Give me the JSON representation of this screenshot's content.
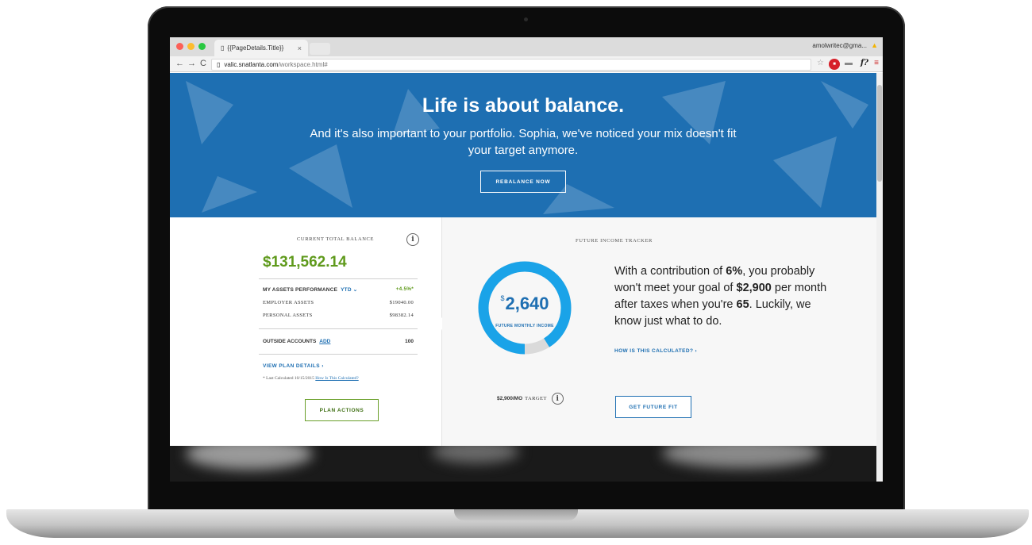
{
  "browser": {
    "tab_title": "{{PageDetails.Title}}",
    "tab_close": "×",
    "user": "amolwritec@gma...",
    "url_host": "valic.snatlanta.com",
    "url_path": "/workspace.html#"
  },
  "hero": {
    "title": "Life is about balance.",
    "subtitle": "And it's also important to your portfolio. Sophia, we've noticed your mix doesn't fit your target anymore.",
    "button": "REBALANCE NOW",
    "background_color": "#1e6fb2"
  },
  "balance": {
    "label": "CURRENT TOTAL BALANCE",
    "info_glyph": "i",
    "amount": "$131,562.14",
    "performance_label": "MY ASSETS PERFORMANCE",
    "performance_period": "YTD ⌄",
    "performance_value": "+4.5%*",
    "employer_label": "EMPLOYER ASSETS",
    "employer_value": "$19040.00",
    "personal_label": "PERSONAL ASSETS",
    "personal_value": "$98382.14",
    "outside_label": "OUTSIDE ACCOUNTS",
    "outside_add": "ADD",
    "outside_value": "100",
    "view_plan": "VIEW PLAN DETAILS ›",
    "last_calc": "* Last Calculated 10/15/2015",
    "how_calc": "How Is This Calculated?",
    "plan_button": "PLAN ACTIONS"
  },
  "tracker": {
    "label": "FUTURE INCOME TRACKER",
    "currency": "$",
    "monthly_income": "2,640",
    "monthly_income_label": "FUTURE MONTHLY INCOME",
    "target_amount": "$2,900/MO",
    "target_word": "TARGET",
    "info_glyph": "i",
    "progress_fraction": 0.91,
    "message_parts": [
      "With a contribution of ",
      "6%",
      ", you probably won't meet your goal of ",
      "$2,900",
      " per month after taxes when you're ",
      "65",
      ". Luckily, we know just what to do."
    ],
    "how_link": "HOW IS THIS CALCULATED? ›",
    "fit_button": "GET FUTURE FIT",
    "ring_color": "#1aa3e8",
    "ring_remainder_color": "#dadada"
  },
  "colors": {
    "green": "#5f9a1c",
    "blue": "#1e6fb2"
  }
}
